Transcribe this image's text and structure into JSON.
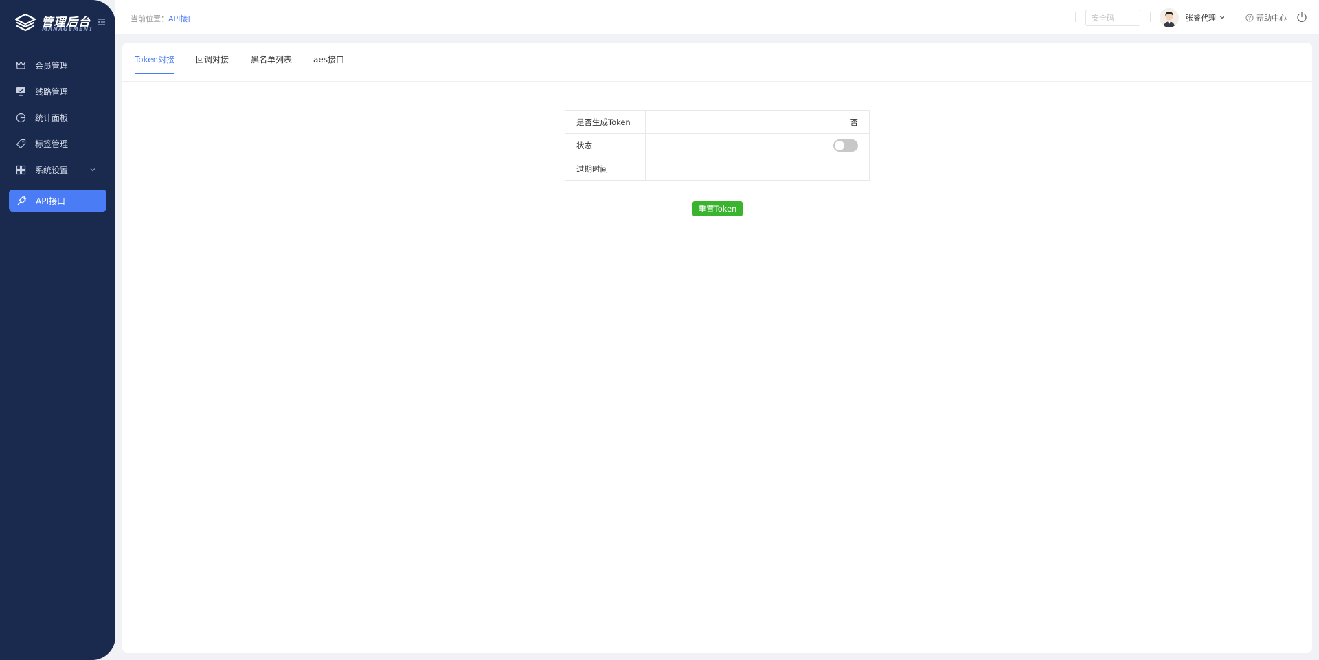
{
  "brand": {
    "title": "管理后台",
    "subtitle": "MANAGEMENT"
  },
  "sidebar": {
    "items": [
      {
        "label": "会员管理",
        "icon": "crown-icon"
      },
      {
        "label": "线路管理",
        "icon": "monitor-icon"
      },
      {
        "label": "统计面板",
        "icon": "pie-chart-icon"
      },
      {
        "label": "标签管理",
        "icon": "tag-icon"
      },
      {
        "label": "系统设置",
        "icon": "grid-icon",
        "has_submenu": true
      },
      {
        "label": "API接口",
        "icon": "plug-icon",
        "active": true
      }
    ]
  },
  "header": {
    "breadcrumb_prefix": "当前位置：",
    "breadcrumb_current": "API接口",
    "security_placeholder": "安全码",
    "user_name": "张睿代理",
    "help_label": "帮助中心"
  },
  "tabs": [
    {
      "label": "Token对接",
      "active": true
    },
    {
      "label": "回调对接"
    },
    {
      "label": "黑名单列表"
    },
    {
      "label": "aes接口"
    }
  ],
  "token_table": {
    "rows": [
      {
        "label": "是否生成Token",
        "value": "否"
      },
      {
        "label": "状态",
        "value_type": "switch",
        "switch_on": false
      },
      {
        "label": "过期时间",
        "value": ""
      }
    ]
  },
  "reset_button_label": "重置Token",
  "colors": {
    "sidebar_bg": "#1a2a4f",
    "accent": "#4a7cf5",
    "success": "#3ab42f"
  }
}
